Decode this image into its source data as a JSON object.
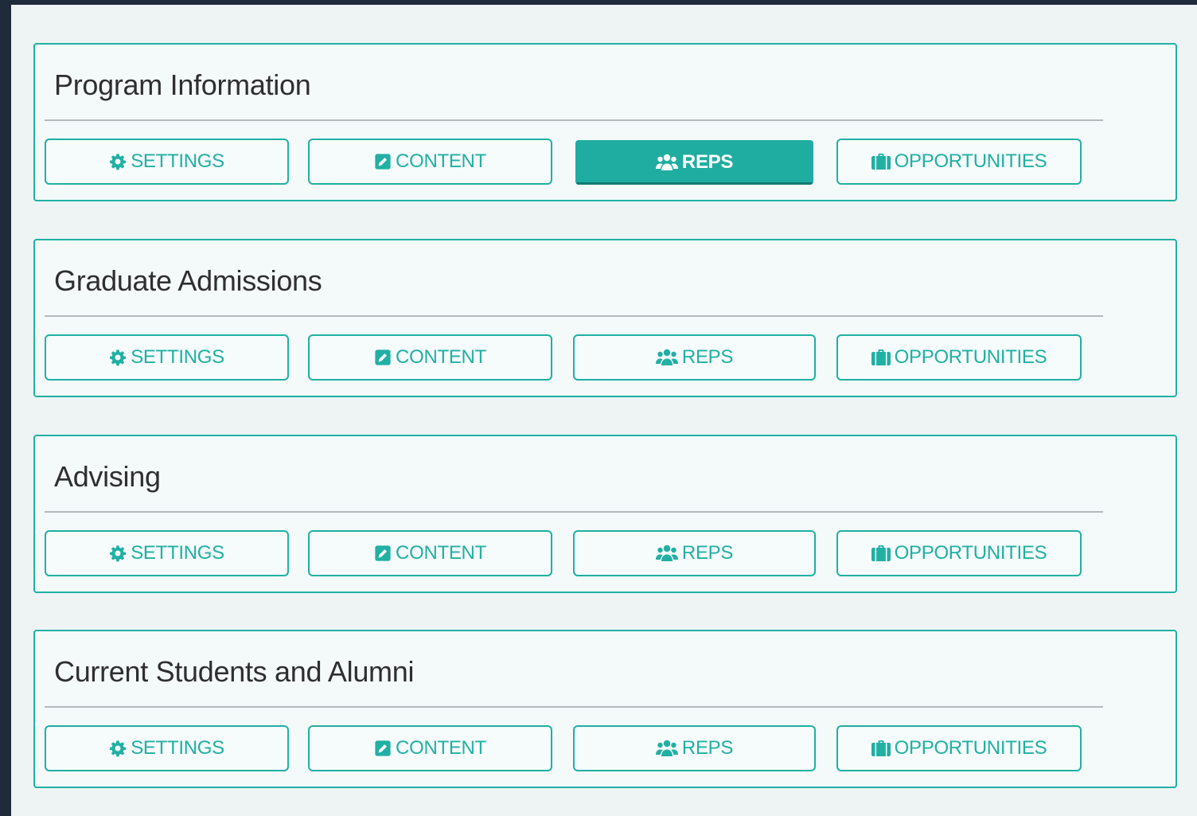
{
  "sections": [
    {
      "title": "Program Information",
      "buttons": {
        "settings": "SETTINGS",
        "content": "CONTENT",
        "reps": "REPS",
        "opportunities": "OPPORTUNITIES"
      },
      "active": "reps"
    },
    {
      "title": "Graduate Admissions",
      "buttons": {
        "settings": "SETTINGS",
        "content": "CONTENT",
        "reps": "REPS",
        "opportunities": "OPPORTUNITIES"
      },
      "active": ""
    },
    {
      "title": "Advising",
      "buttons": {
        "settings": "SETTINGS",
        "content": "CONTENT",
        "reps": "REPS",
        "opportunities": "OPPORTUNITIES"
      },
      "active": ""
    },
    {
      "title": "Current Students and Alumni",
      "buttons": {
        "settings": "SETTINGS",
        "content": "CONTENT",
        "reps": "REPS",
        "opportunities": "OPPORTUNITIES"
      },
      "active": ""
    }
  ],
  "icons": {
    "settings": "gear-icon",
    "content": "edit-icon",
    "reps": "users-icon",
    "opportunities": "briefcase-icon"
  },
  "colors": {
    "accent": "#20b0a4",
    "active_background": "#20ada1",
    "active_text": "#ffffff",
    "page_background": "#eef4f4",
    "frame_background": "#1f2a3a",
    "title_text": "#2f2f2f",
    "rule": "#b5b9bb"
  }
}
